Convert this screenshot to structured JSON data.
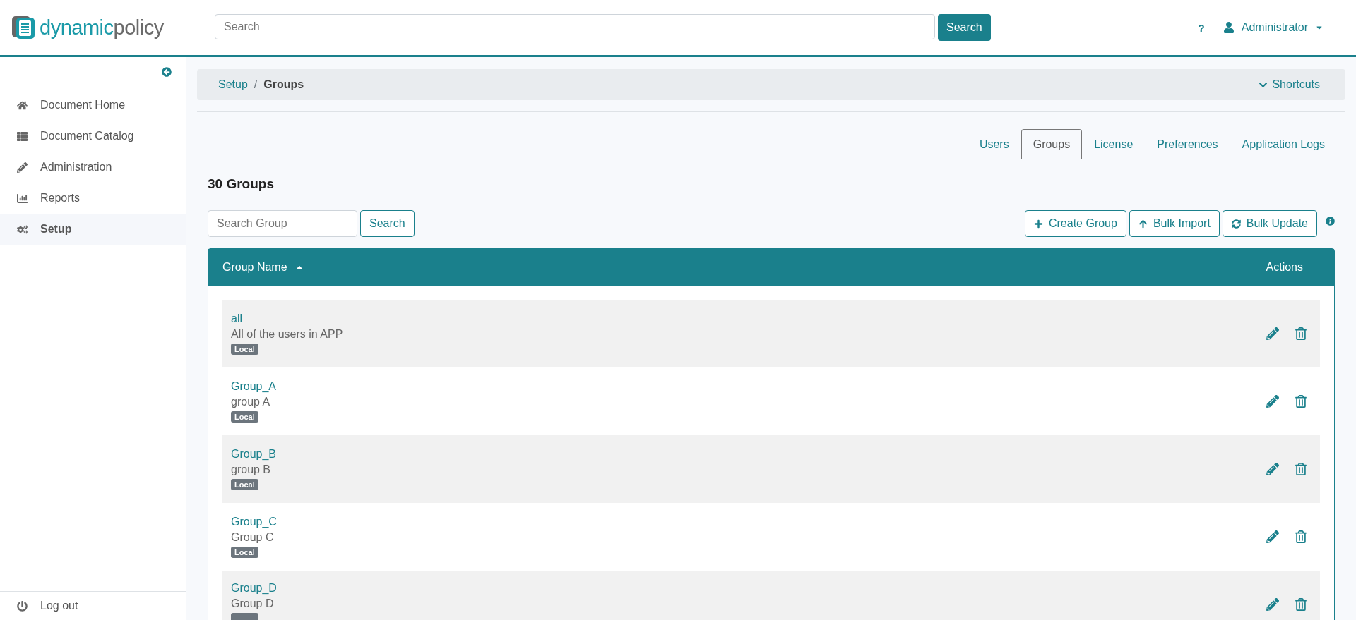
{
  "header": {
    "logo": {
      "part_1": "dynamic",
      "part_2": "policy"
    },
    "search": {
      "placeholder": "Search",
      "button": "Search"
    },
    "help": "?",
    "user": "Administrator"
  },
  "sidebar": {
    "items": [
      {
        "label": "Document Home",
        "kind": "home",
        "selected": false
      },
      {
        "label": "Document Catalog",
        "kind": "list",
        "selected": false
      },
      {
        "label": "Administration",
        "kind": "pencil",
        "selected": false
      },
      {
        "label": "Reports",
        "kind": "chart",
        "selected": false
      },
      {
        "label": "Setup",
        "kind": "gears",
        "selected": true
      }
    ],
    "logout": "Log out"
  },
  "breadcrumb": {
    "items": [
      "Setup",
      "Groups"
    ],
    "separator": "/",
    "shortcuts": "Shortcuts"
  },
  "tabs": [
    {
      "label": "Users",
      "selected": false
    },
    {
      "label": "Groups",
      "selected": true
    },
    {
      "label": "License",
      "selected": false
    },
    {
      "label": "Preferences",
      "selected": false
    },
    {
      "label": "Application Logs",
      "selected": false
    }
  ],
  "title": "30 Groups",
  "group_search": {
    "placeholder": "Search Group",
    "button": "Search"
  },
  "actions": [
    {
      "label": "Create Group",
      "kind": "plus"
    },
    {
      "label": "Bulk Import",
      "kind": "upload"
    },
    {
      "label": "Bulk Update",
      "kind": "refresh"
    }
  ],
  "table": {
    "columns": [
      {
        "label": "Group Name",
        "sorted": true
      },
      {
        "label": "Actions"
      }
    ],
    "rows": [
      {
        "name": "all",
        "description": "All of the users in APP",
        "badge": "Local"
      },
      {
        "name": "Group_A",
        "description": "group A",
        "badge": "Local"
      },
      {
        "name": "Group_B",
        "description": "group B",
        "badge": "Local"
      },
      {
        "name": "Group_C",
        "description": "Group C",
        "badge": "Local"
      },
      {
        "name": "Group_D",
        "description": "Group D"
      }
    ]
  }
}
